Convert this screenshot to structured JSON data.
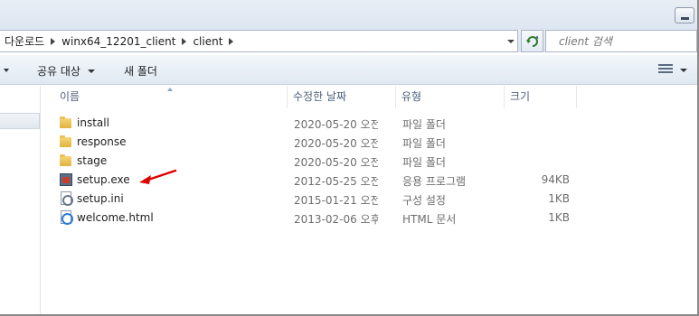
{
  "address": {
    "crumbs": [
      "다운로드",
      "winx64_12201_client",
      "client"
    ]
  },
  "search": {
    "placeholder": "client 검색"
  },
  "toolbar": {
    "share_label": "공유 대상",
    "new_folder_label": "새 폴더"
  },
  "columns": {
    "name": "이름",
    "date": "수정한 날짜",
    "type": "유형",
    "size": "크기"
  },
  "files": [
    {
      "name": "install",
      "date": "2020-05-20 오전...",
      "type": "파일 폴더",
      "size": "",
      "icon": "folder-icon"
    },
    {
      "name": "response",
      "date": "2020-05-20 오전...",
      "type": "파일 폴더",
      "size": "",
      "icon": "folder-icon"
    },
    {
      "name": "stage",
      "date": "2020-05-20 오전...",
      "type": "파일 폴더",
      "size": "",
      "icon": "folder-icon"
    },
    {
      "name": "setup.exe",
      "date": "2012-05-25 오전...",
      "type": "응용 프로그램",
      "size": "94KB",
      "icon": "exe-icon"
    },
    {
      "name": "setup.ini",
      "date": "2015-01-21 오전...",
      "type": "구성 설정",
      "size": "1KB",
      "icon": "ini-settings-icon"
    },
    {
      "name": "welcome.html",
      "date": "2013-02-06 오후...",
      "type": "HTML 문서",
      "size": "1KB",
      "icon": "ie-html-icon"
    }
  ],
  "colors": {
    "annotation": "#e00000",
    "header_text": "#4c607a",
    "detail_text": "#6d6d6d"
  }
}
